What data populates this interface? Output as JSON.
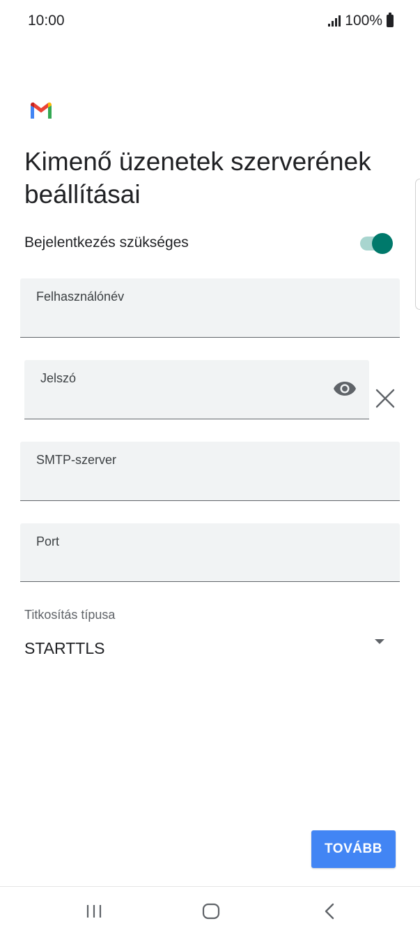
{
  "status_bar": {
    "time": "10:00",
    "battery": "100%"
  },
  "header": {
    "logo_icon": "gmail-logo",
    "title": "Kimenő üzenetek szerverének beállításai"
  },
  "login_required": {
    "label": "Bejelentkezés szükséges",
    "enabled": true
  },
  "fields": {
    "username": {
      "label": "Felhasználónév",
      "value": ""
    },
    "password": {
      "label": "Jelszó",
      "value": ""
    },
    "smtp": {
      "label": "SMTP-szerver",
      "value": ""
    },
    "port": {
      "label": "Port",
      "value": ""
    }
  },
  "encryption": {
    "label": "Titkosítás típusa",
    "selected": "STARTTLS"
  },
  "actions": {
    "next_label": "TOVÁBB"
  },
  "colors": {
    "accent_toggle": "#00796b",
    "button": "#4285f4",
    "field_bg": "#f1f3f4"
  }
}
